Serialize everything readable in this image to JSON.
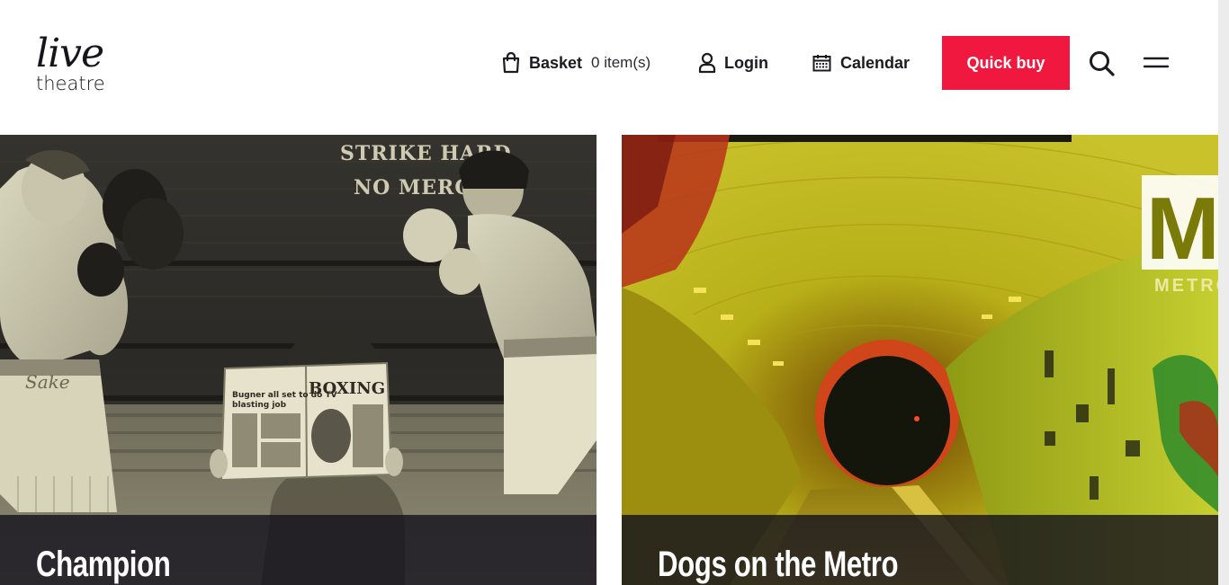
{
  "brand": {
    "logo_top": "live",
    "logo_bottom": "theatre"
  },
  "header": {
    "basket_label": "Basket",
    "basket_count": "0 item(s)",
    "login_label": "Login",
    "calendar_label": "Calendar",
    "quick_buy_label": "Quick buy",
    "search_icon": "search-icon",
    "menu_icon": "hamburger-menu-icon"
  },
  "shows": [
    {
      "title": "Champion",
      "poster_text": {
        "sign_line_1": "STRIKE HARD",
        "sign_line_2": "NO MERCY",
        "newspaper_masthead": "BOXING",
        "newspaper_headline": "Bugner all set to do TV blasting job"
      }
    },
    {
      "title": "Dogs on the Metro",
      "poster_text": {
        "sign_letter": "M",
        "sign_word": "METRO"
      }
    }
  ],
  "colors": {
    "accent": "#f0183f",
    "text": "#1b1b22",
    "overlay": "#16141e"
  }
}
